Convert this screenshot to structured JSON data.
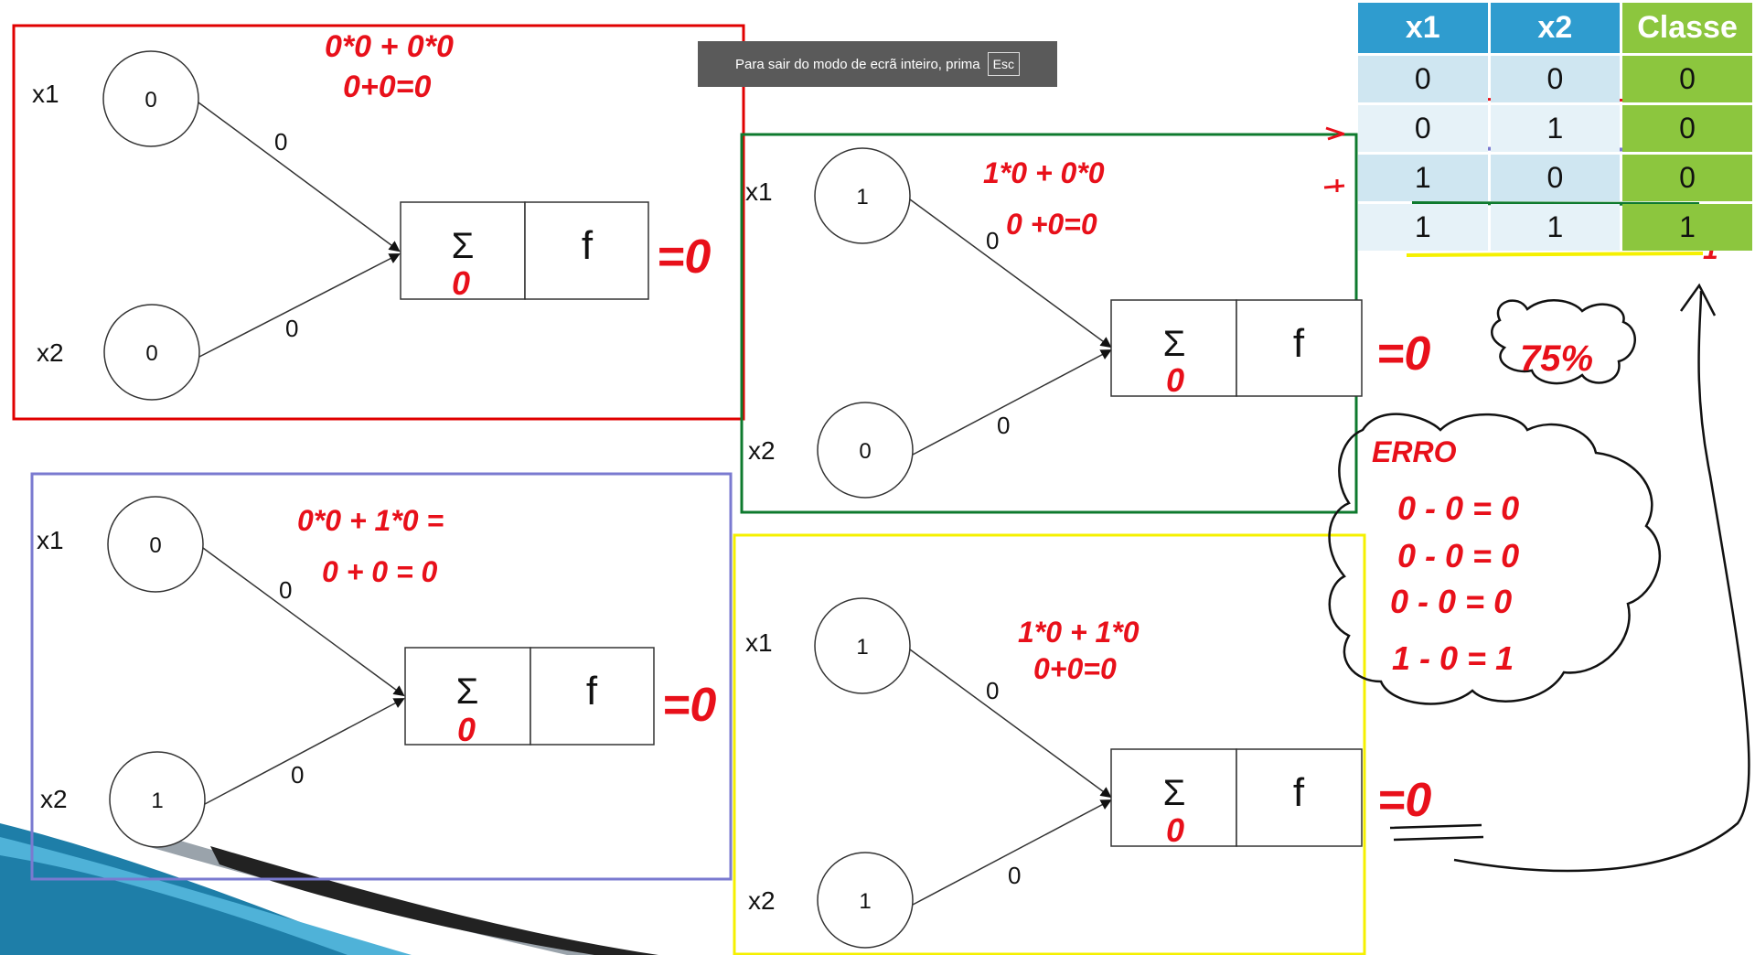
{
  "notification": {
    "text": "Para sair do modo de ecrã inteiro, prima",
    "key": "Esc"
  },
  "table": {
    "headers": [
      "x1",
      "x2",
      "Classe"
    ],
    "rows": [
      [
        "0",
        "0",
        "0"
      ],
      [
        "0",
        "1",
        "0"
      ],
      [
        "1",
        "0",
        "0"
      ],
      [
        "1",
        "1",
        "1"
      ]
    ]
  },
  "perceptrons": [
    {
      "x1_label": "x1",
      "x2_label": "x2",
      "x1": "0",
      "x2": "0",
      "w1": "0",
      "w2": "0",
      "sigma": "Σ",
      "f": "f",
      "sum": "0",
      "out": "=0",
      "calc1": "0*0 + 0*0",
      "calc2": "0+0=0"
    },
    {
      "x1_label": "x1",
      "x2_label": "x2",
      "x1": "1",
      "x2": "0",
      "w1": "0",
      "w2": "0",
      "sigma": "Σ",
      "f": "f",
      "sum": "0",
      "out": "=0",
      "calc1": "1*0 + 0*0",
      "calc2": "0 +0=0"
    },
    {
      "x1_label": "x1",
      "x2_label": "x2",
      "x1": "0",
      "x2": "1",
      "w1": "0",
      "w2": "0",
      "sigma": "Σ",
      "f": "f",
      "sum": "0",
      "out": "=0",
      "calc1": "0*0 + 1*0 =",
      "calc2": "0 + 0 = 0"
    },
    {
      "x1_label": "x1",
      "x2_label": "x2",
      "x1": "1",
      "x2": "1",
      "w1": "0",
      "w2": "0",
      "sigma": "Σ",
      "f": "f",
      "sum": "0",
      "out": "=0",
      "calc1": "1*0 + 1*0",
      "calc2": "0+0=0"
    }
  ],
  "annotations": {
    "accuracy": "75%",
    "error_title": "ERRO",
    "error_lines": [
      "0 - 0 = 0",
      "0 - 0 = 0",
      "0 - 0 = 0",
      "1 - 0 = 1"
    ],
    "row4_mark": "1",
    "colors": {
      "red": "#e8101a",
      "blue": "#7a7ad0",
      "green": "#0e7a2e",
      "yellow": "#f5f000",
      "box_red": "#e00000"
    }
  }
}
